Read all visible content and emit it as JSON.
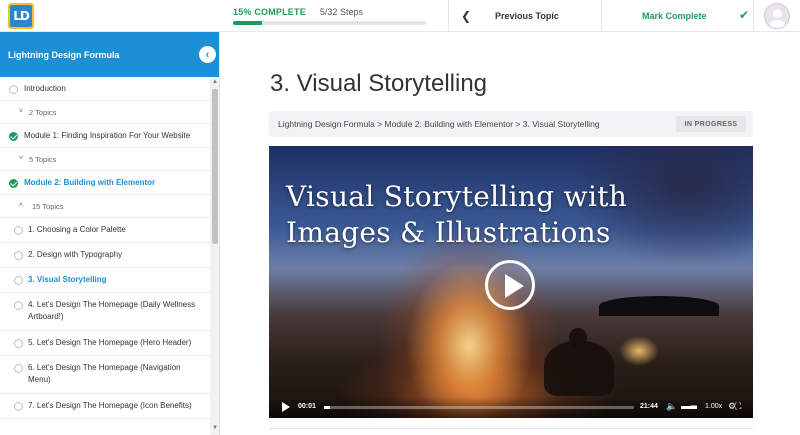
{
  "app": {
    "logo_text": "LD",
    "colors": {
      "accent": "#1c8fd6",
      "success": "#1d9b5c",
      "logo_bg": "#f2c22d",
      "logo_inner": "#2b87c9"
    }
  },
  "topbar": {
    "progress_percent_label": "15% COMPLETE",
    "progress_fraction": 0.15,
    "steps_label": "5/32 Steps",
    "prev_icon": "chevron-left-icon",
    "prev_label": "Previous Topic",
    "mark_complete_label": "Mark Complete",
    "check_icon": "check-icon",
    "avatar_icon": "user-avatar-icon"
  },
  "sidebar": {
    "title": "Lightning Design Formula",
    "collapse_icon": "chevron-left-icon",
    "items": [
      {
        "label": "Introduction",
        "status": "empty"
      },
      {
        "sub_label": "2 Topics",
        "caret": "˅"
      },
      {
        "label": "Module 1: Finding Inspiration For Your Website",
        "status": "done"
      },
      {
        "sub_label": "5 Topics",
        "caret": "˅"
      },
      {
        "label": "Module 2: Building with Elementor",
        "status": "done",
        "active": true
      },
      {
        "sub_label": "15 Topics",
        "caret": "˄"
      },
      {
        "label": "1. Choosing a Color Palette",
        "status": "empty"
      },
      {
        "label": "2. Design with Typography",
        "status": "empty"
      },
      {
        "label": "3. Visual Storytelling",
        "status": "empty",
        "active": true
      },
      {
        "label": "4. Let's Design The Homepage (Daily Wellness Artboard!)",
        "status": "empty"
      },
      {
        "label": "5. Let's Design The Homepage (Hero Header)",
        "status": "empty"
      },
      {
        "label": "6. Let's Design The Homepage (Navigation Menu)",
        "status": "empty"
      },
      {
        "label": "7. Let's Design The Homepage (Icon Benefits)",
        "status": "empty"
      }
    ]
  },
  "main": {
    "title": "3. Visual Storytelling",
    "breadcrumb": "Lightning Design Formula > Module 2: Building with Elementor > 3. Visual Storytelling",
    "status_badge": "IN PROGRESS",
    "video": {
      "title_line1": "Visual Storytelling with",
      "title_line2": "Images & Illustrations",
      "current_time": "00:01",
      "duration": "21:44",
      "speed": "1.00x",
      "progress_fraction": 0.02
    }
  }
}
